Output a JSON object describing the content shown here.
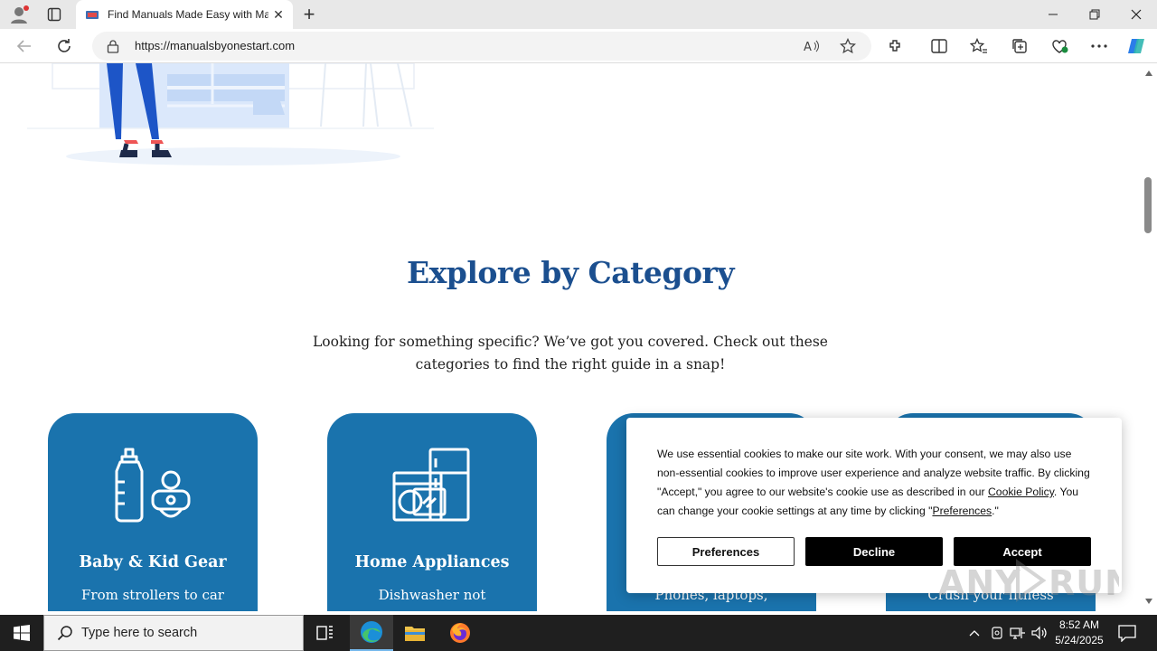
{
  "browser": {
    "tab_title": "Find Manuals Made Easy with Ma",
    "url": "https://manualsbyonestart.com"
  },
  "page": {
    "section_title": "Explore by Category",
    "section_subtitle": "Looking for something specific? We’ve got you covered. Check out these categories to find the right guide in a snap!",
    "cards": [
      {
        "title": "Baby & Kid Gear",
        "desc": "From strollers to car"
      },
      {
        "title": "Home Appliances",
        "desc": "Dishwasher not"
      },
      {
        "title": "",
        "desc": "Phones, laptops,"
      },
      {
        "title": "",
        "desc": "Crush your fitness"
      }
    ],
    "accent_color": "#1b4f8f",
    "card_color": "#1a73ad"
  },
  "cookie_banner": {
    "text_1": "We use essential cookies to make our site work. With your consent, we may also use non-essential cookies to improve user experience and analyze website traffic. By clicking \"Accept,\" you agree to our website's cookie use as described in our ",
    "policy_link": "Cookie Policy",
    "text_2": ". You can change your cookie settings at any time by clicking \"",
    "preferences_link": "Preferences",
    "text_3": ".\"",
    "preferences_button": "Preferences",
    "decline_button": "Decline",
    "accept_button": "Accept"
  },
  "watermark": "ANY RUN",
  "taskbar": {
    "search_placeholder": "Type here to search",
    "time": "8:52 AM",
    "date": "5/24/2025"
  }
}
